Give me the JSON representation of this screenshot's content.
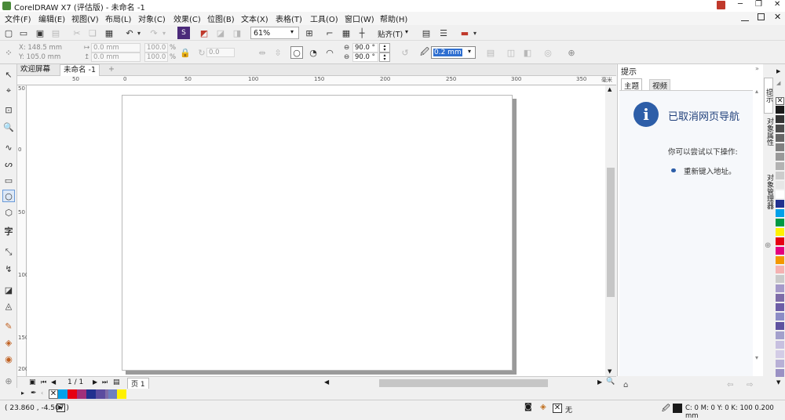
{
  "title": {
    "text": "CorelDRAW X7 (评估版) - 未命名 -1",
    "minimize": "─",
    "restore": "❐",
    "close": "✕"
  },
  "menu": [
    "文件(F)",
    "编辑(E)",
    "视图(V)",
    "布局(L)",
    "对象(C)",
    "效果(C)",
    "位图(B)",
    "文本(X)",
    "表格(T)",
    "工具(O)",
    "窗口(W)",
    "帮助(H)"
  ],
  "toolbar": {
    "zoom": "61%",
    "snap": "贴齐(T)"
  },
  "props": {
    "x": "X: 148.5 mm",
    "y": "Y: 105.0 mm",
    "w": "0.0 mm",
    "h": "0.0 mm",
    "sx": "100.0",
    "sy": "100.0",
    "pct": "%",
    "rot": "0.0",
    "angle1": "90.0 °",
    "angle2": "90.0 °",
    "outline": "0.2 mm"
  },
  "tabs": {
    "welcome": "欢迎屏幕",
    "doc": "未命名 -1",
    "add": "+"
  },
  "ruler": [
    "50",
    "0",
    "50",
    "100",
    "150",
    "200",
    "250",
    "300",
    "350"
  ],
  "ruler_unit": "毫米",
  "vruler": [
    "50",
    "0",
    "50",
    "100",
    "150",
    "200"
  ],
  "hint": {
    "title": "提示",
    "tab_topic": "主题",
    "tab_video": "视频",
    "heading": "已取消网页导航",
    "body": "你可以尝试以下操作:",
    "bullet": "重新键入地址。"
  },
  "sidetabs": [
    "提示",
    "对象属性",
    "对象管理器"
  ],
  "pages": {
    "counter": "1 / 1",
    "tab": "页 1"
  },
  "status": {
    "coords": "( 23.860 , -4.507 )",
    "fill_none": "无",
    "outline_info": "C: 0 M: 0 Y: 0 K: 100  0.200 mm"
  },
  "palette_colors": [
    "#ffffff",
    "#1a1a1a",
    "#333333",
    "#4d4d4d",
    "#666666",
    "#808080",
    "#999999",
    "#b3b3b3",
    "#cccccc",
    "#e6e6e6",
    "#ffffff",
    "#22318f",
    "#00a0e9",
    "#009944",
    "#fff100",
    "#e60012",
    "#e4007f",
    "#f39800",
    "#f5b2b2",
    "#c9caca",
    "#a59aca",
    "#7e6ca8",
    "#6d5ea7",
    "#8c8cc6",
    "#5f52a0",
    "#a3a0cc",
    "#c7c0e0",
    "#d3cce6",
    "#b8b0d6",
    "#9a91c4",
    "#7a6fb0"
  ],
  "docpal_colors": [
    "#00a0e9",
    "#e60012",
    "#a0307a",
    "#22318f",
    "#5b4c9f",
    "#7e6ca8",
    "#6d7fc0",
    "#fff100"
  ]
}
